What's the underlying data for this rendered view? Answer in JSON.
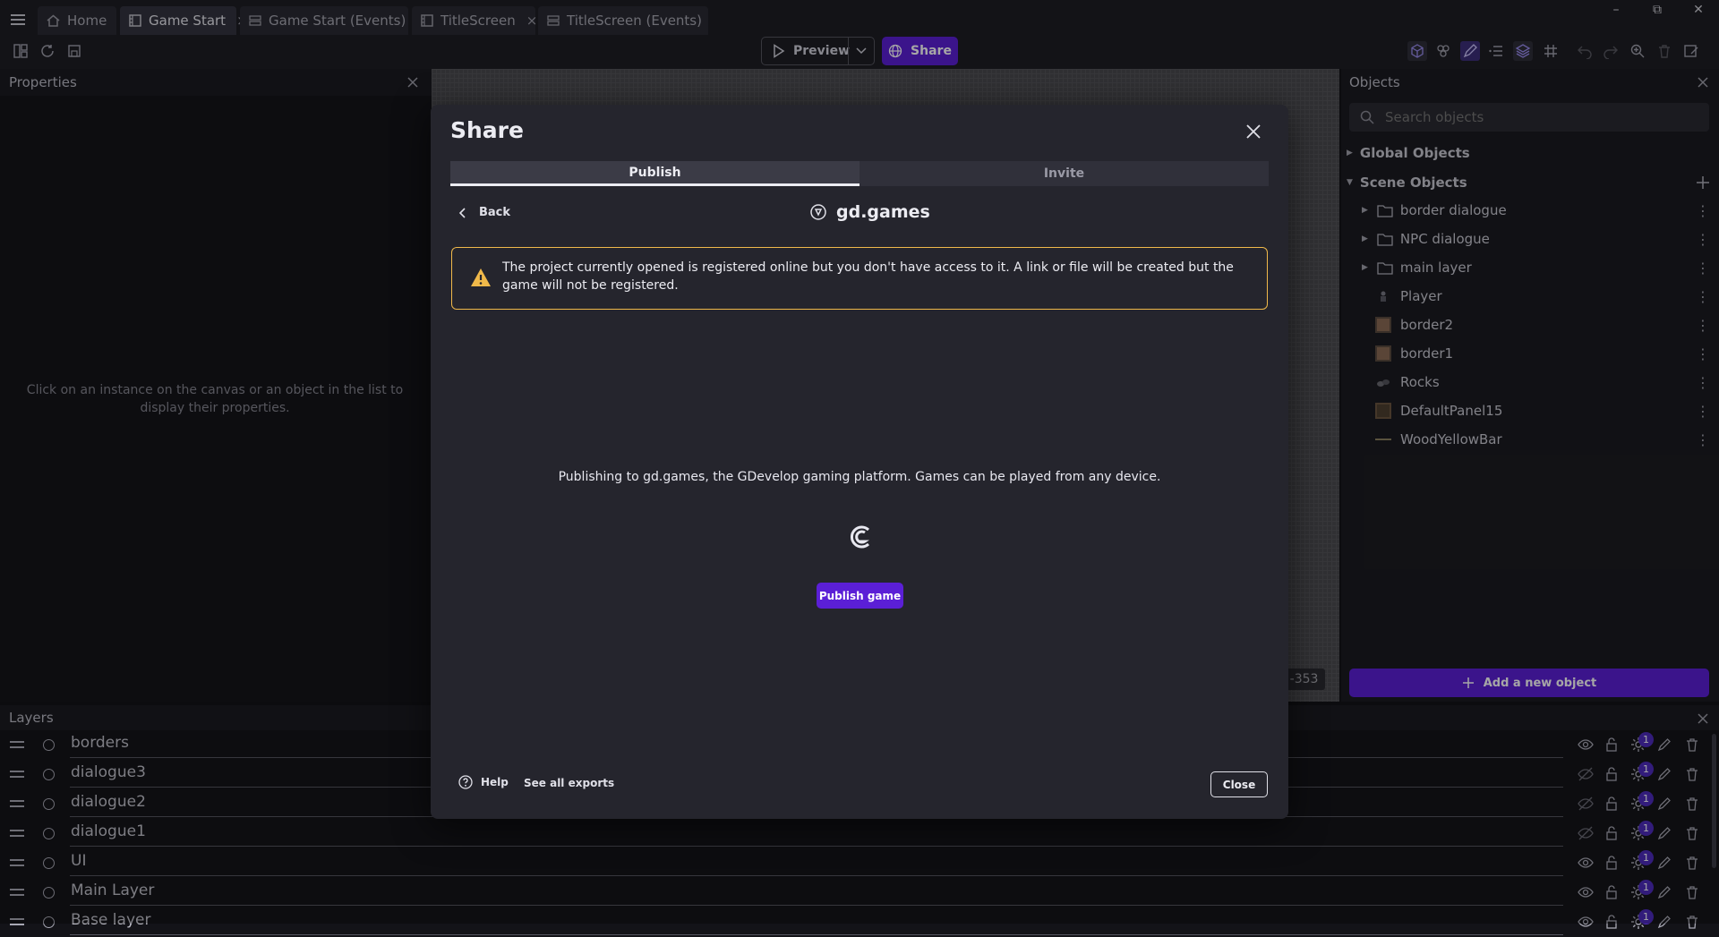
{
  "titlebar": {
    "tabs": [
      {
        "label": "Home",
        "icon": "home-icon",
        "active": false
      },
      {
        "label": "Game Start",
        "icon": "scene-icon",
        "active": true
      },
      {
        "label": "Game Start (Events)",
        "icon": "events-icon",
        "active": false
      },
      {
        "label": "TitleScreen",
        "icon": "scene-icon",
        "active": false
      },
      {
        "label": "TitleScreen (Events)",
        "icon": "events-icon",
        "active": false
      }
    ],
    "close_glyph": "×"
  },
  "toolbar": {
    "preview_label": "Preview",
    "share_label": "Share"
  },
  "properties": {
    "title": "Properties",
    "empty_hint": "Click on an instance on the canvas or an object in the list to display their properties."
  },
  "canvas": {
    "coords": "; -353"
  },
  "objects": {
    "title": "Objects",
    "search_placeholder": "Search objects",
    "global_label": "Global Objects",
    "scene_label": "Scene Objects",
    "folders": [
      "border dialogue",
      "NPC dialogue",
      "main layer"
    ],
    "items": [
      {
        "name": "Player",
        "icon": "sprite-icon"
      },
      {
        "name": "border2",
        "icon": "tiled-sprite-icon"
      },
      {
        "name": "border1",
        "icon": "tiled-sprite-icon"
      },
      {
        "name": "Rocks",
        "icon": "sprite-icon"
      },
      {
        "name": "DefaultPanel15",
        "icon": "panel-sprite-icon"
      },
      {
        "name": "WoodYellowBar",
        "icon": "bar-icon"
      }
    ],
    "add_label": "Add a new object"
  },
  "layers": {
    "title": "Layers",
    "rows": [
      {
        "name": "borders",
        "visible": true,
        "effects": "1"
      },
      {
        "name": "dialogue3",
        "visible": false,
        "effects": "1"
      },
      {
        "name": "dialogue2",
        "visible": false,
        "effects": "1"
      },
      {
        "name": "dialogue1",
        "visible": false,
        "effects": "1"
      },
      {
        "name": "UI",
        "visible": true,
        "effects": "1"
      },
      {
        "name": "Main Layer",
        "visible": true,
        "effects": "1"
      },
      {
        "name": "Base layer",
        "visible": true,
        "effects": "1"
      }
    ]
  },
  "share_dialog": {
    "title": "Share",
    "tabs": [
      "Publish",
      "Invite"
    ],
    "back_label": "Back",
    "platform_name": "gd.games",
    "warning_text": "The project currently opened is registered online but you don't have access to it. A link or file will be created but the game will not be registered.",
    "description": "Publishing to gd.games, the GDevelop gaming platform. Games can be played from any device.",
    "publish_button": "Publish game",
    "help_label": "Help",
    "see_all_label": "See all exports",
    "close_label": "Close",
    "colors": {
      "accent": "#5b1fd6",
      "warning": "#f0b94a"
    }
  }
}
